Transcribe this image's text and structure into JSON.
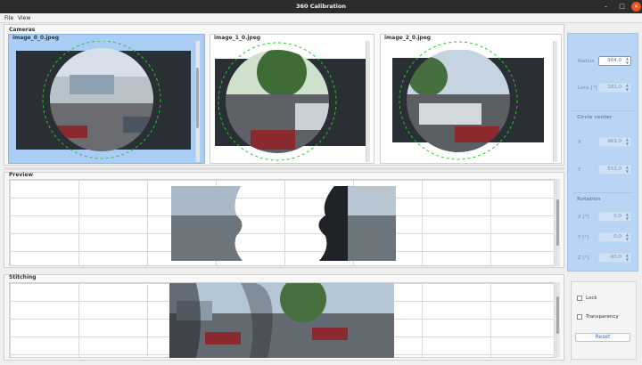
{
  "window": {
    "title": "360 Calibration",
    "min_glyph": "–",
    "max_glyph": "□",
    "close_glyph": "✕"
  },
  "menu": {
    "file": "File",
    "view": "View"
  },
  "cameras": {
    "label": "Cameras",
    "images": [
      {
        "name": "image_0_0.jpeg",
        "selected": true
      },
      {
        "name": "image_1_0.jpeg",
        "selected": false
      },
      {
        "name": "image_2_0.jpeg",
        "selected": false
      }
    ]
  },
  "preview": {
    "label": "Preview"
  },
  "stitching": {
    "label": "Stitching"
  },
  "lens_params": {
    "radius_label": "Radius",
    "radius_value": "964,0",
    "lens_label": "Lens [°]",
    "lens_value": "181,0",
    "circle_center_label": "Circle center",
    "x_label": "X",
    "x_value": "963,0",
    "y_label": "Y",
    "y_value": "552,0"
  },
  "rotation": {
    "label": "Rotation",
    "x_label": "X [°]",
    "x_value": "0,0",
    "y_label": "Y [°]",
    "y_value": "0,0",
    "z_label": "Z [°]",
    "z_value": "-90,0"
  },
  "controls": {
    "lock_label": "Lock",
    "lock_checked": false,
    "transparency_label": "Transparency",
    "transparency_checked": false,
    "reset_label": "Reset"
  },
  "colors": {
    "accent": "#a9cdf5",
    "circle": "#22cc22",
    "close_button": "#e95420"
  }
}
